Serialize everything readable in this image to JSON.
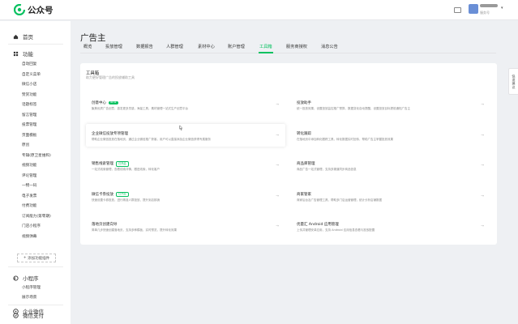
{
  "app": {
    "name": "公众号",
    "account_type": "服务号",
    "accent": "#07c160"
  },
  "sidebar": {
    "home": "首页",
    "functions": "功能",
    "function_items": [
      "自动回复",
      "自定义菜单",
      "微信小店",
      "赞赏功能",
      "话题标签",
      "留言管理",
      "投票管理",
      "页面模板",
      "原创",
      "专辑(原卫星维和)",
      "视频功能",
      "评论管理",
      "一物一码",
      "电子发票",
      "付费功能",
      "订阅能力(第零期)",
      "门店小程序",
      "视频弹幕"
    ],
    "add_plugin": "添加功能插件",
    "miniprogram": "小程序",
    "miniprogram_items": [
      "小程序管理",
      "展示场景"
    ],
    "wechat_pay": "微信支付",
    "enterprise_wechat": "企业微信"
  },
  "main": {
    "title": "广告主",
    "tabs": [
      "概览",
      "投放管理",
      "数据报告",
      "人群管理",
      "素材中心",
      "账户管理",
      "工具箱",
      "服务商授权",
      "消息公告"
    ],
    "active_tab": 6
  },
  "toolbox": {
    "title": "工具箱",
    "description": "助力更好管理广告的投放辅助工具",
    "tools": [
      {
        "name": "创意中心",
        "badge": "NEW",
        "desc": "聚焦优质广告创意，激发更多灵感，海量工具，素材管理一站式生产创意平台"
      },
      {
        "name": "投放助手",
        "badge": "",
        "desc": "统一投放效果，设置投放监控推广预算，数据变化自动提醒，设置投放目标提前通知广告主"
      },
      {
        "name": "企业微信投放专项管理",
        "badge": "",
        "desc": "帮助企业微信投放在落地页，通过企业微信推广获客，用户可以直接添加企业微信获得专属服务"
      },
      {
        "name": "转化跟踪",
        "badge": "",
        "desc": "在落地页中添加转化跟踪工具，转化数据实时回传，帮助广告主掌握投放效果"
      },
      {
        "name": "销售线索管理",
        "badge": "已开启",
        "desc": "一站式线索管理，查看线索详情，跟进线索，转化客户"
      },
      {
        "name": "商品库管理",
        "badge": "",
        "desc": "商品广告一站式管理，支持多渠道同步商品信息"
      },
      {
        "name": "微信卡券投放",
        "badge": "已开启",
        "desc": "快速设置卡券投放，进行精准人群投放，提升到店核销"
      },
      {
        "name": "商家管家",
        "badge": "",
        "desc": "商家后台及广告管理工具，帮助多门店运营管理，统计分析店铺数据"
      },
      {
        "name": "落地页创建向导",
        "badge": "",
        "desc": "简单几步快速创建落地页，支持多种模板，实时预览，提升转化效果"
      },
      {
        "name": "优量汇 Android 应用管理",
        "badge": "",
        "desc": "上传并管理安卓应用，支持 Android 应用信息查看与投放配置"
      }
    ]
  },
  "float_button": "快速建议"
}
